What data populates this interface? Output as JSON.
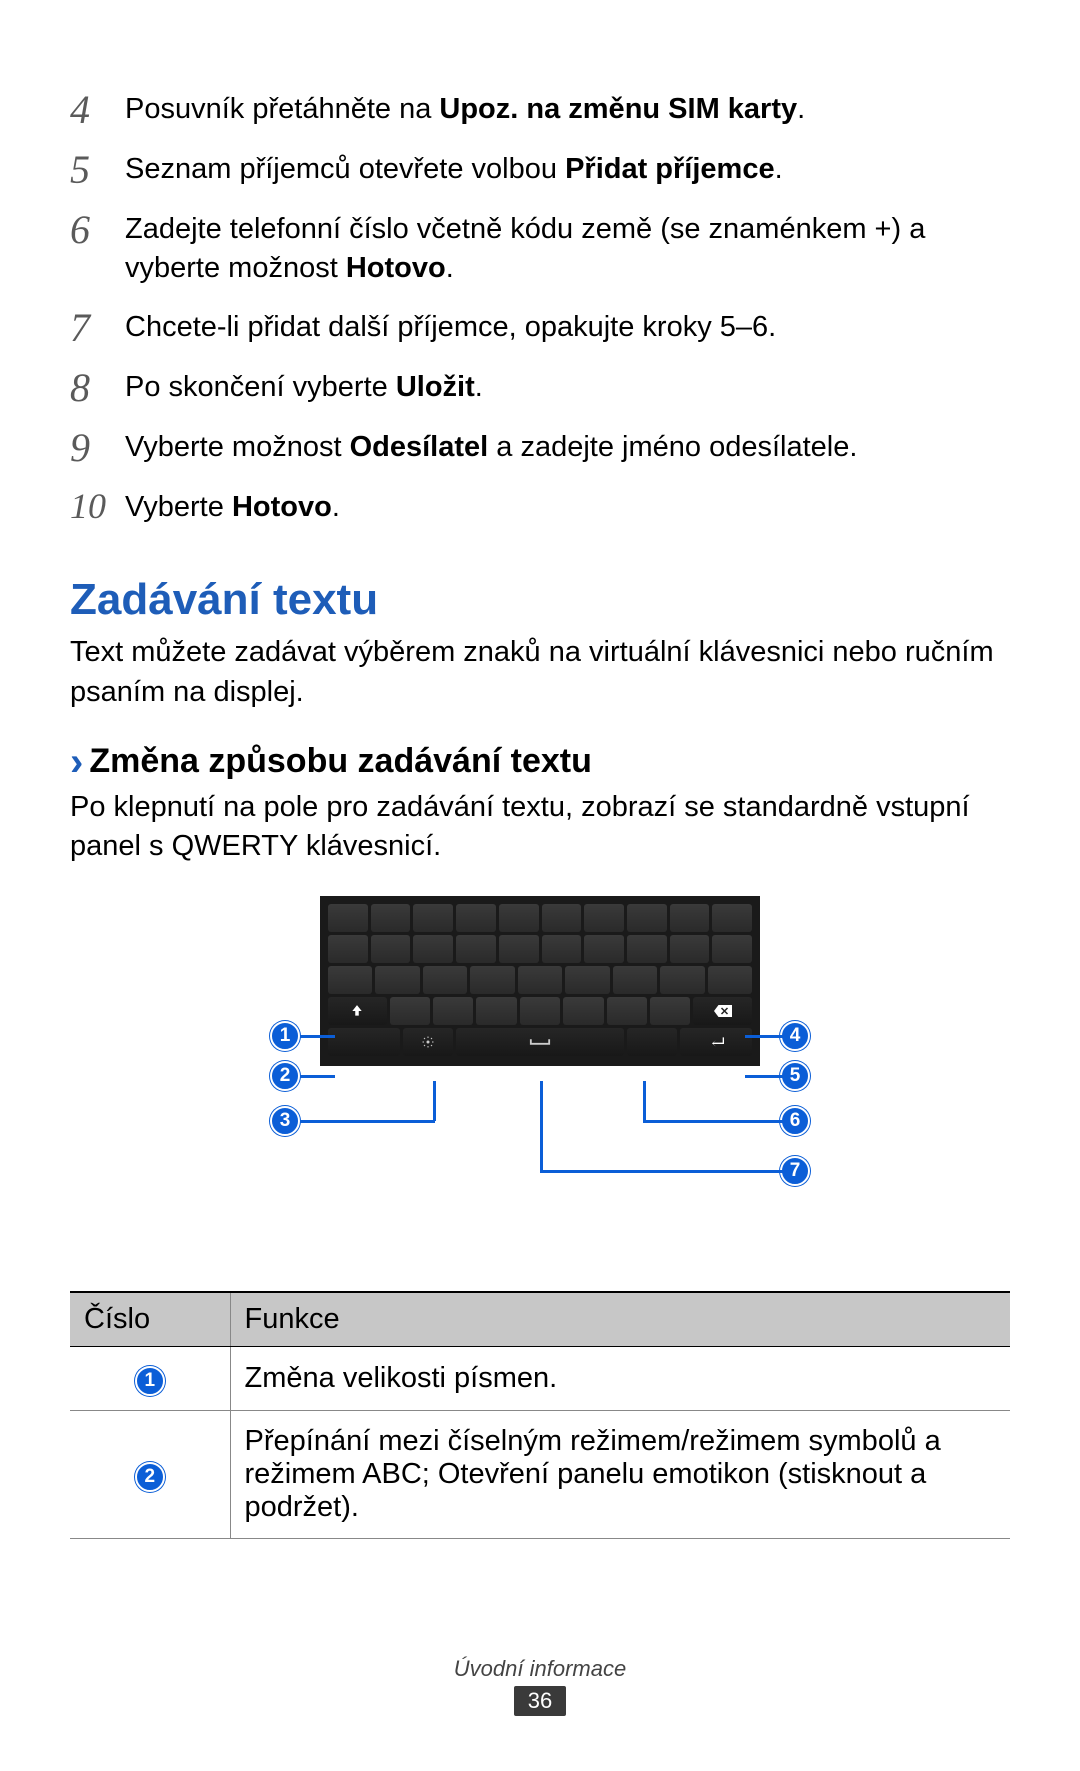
{
  "steps": [
    {
      "num": "4",
      "parts": [
        "Posuvník přetáhněte na ",
        {
          "b": "Upoz. na změnu SIM karty"
        },
        "."
      ]
    },
    {
      "num": "5",
      "parts": [
        "Seznam příjemců otevřete volbou ",
        {
          "b": "Přidat příjemce"
        },
        "."
      ]
    },
    {
      "num": "6",
      "parts": [
        "Zadejte telefonní číslo včetně kódu země (se znaménkem +) a vyberte možnost ",
        {
          "b": "Hotovo"
        },
        "."
      ]
    },
    {
      "num": "7",
      "parts": [
        "Chcete-li přidat další příjemce, opakujte kroky 5–6."
      ]
    },
    {
      "num": "8",
      "parts": [
        "Po skončení vyberte ",
        {
          "b": "Uložit"
        },
        "."
      ]
    },
    {
      "num": "9",
      "parts": [
        "Vyberte možnost ",
        {
          "b": "Odesílatel"
        },
        " a zadejte jméno odesílatele."
      ]
    },
    {
      "num": "10",
      "parts": [
        "Vyberte ",
        {
          "b": "Hotovo"
        },
        "."
      ]
    }
  ],
  "section": {
    "heading": "Zadávání textu",
    "text": "Text můžete zadávat výběrem znaků na virtuální klávesnici nebo ručním psaním na displej."
  },
  "subsection": {
    "heading": "Změna způsobu zadávání textu",
    "text": "Po klepnutí na pole pro zadávání textu, zobrazí se standardně vstupní panel s QWERTY klávesnicí."
  },
  "callouts": [
    "1",
    "2",
    "3",
    "4",
    "5",
    "6",
    "7"
  ],
  "table": {
    "head": {
      "col1": "Číslo",
      "col2": "Funkce"
    },
    "rows": [
      {
        "n": "1",
        "text": "Změna velikosti písmen."
      },
      {
        "n": "2",
        "text": "Přepínání mezi číselným režimem/režimem symbolů a režimem ABC; Otevření panelu emotikon (stisknout a podržet)."
      }
    ]
  },
  "footer": {
    "text": "Úvodní informace",
    "page": "36"
  }
}
